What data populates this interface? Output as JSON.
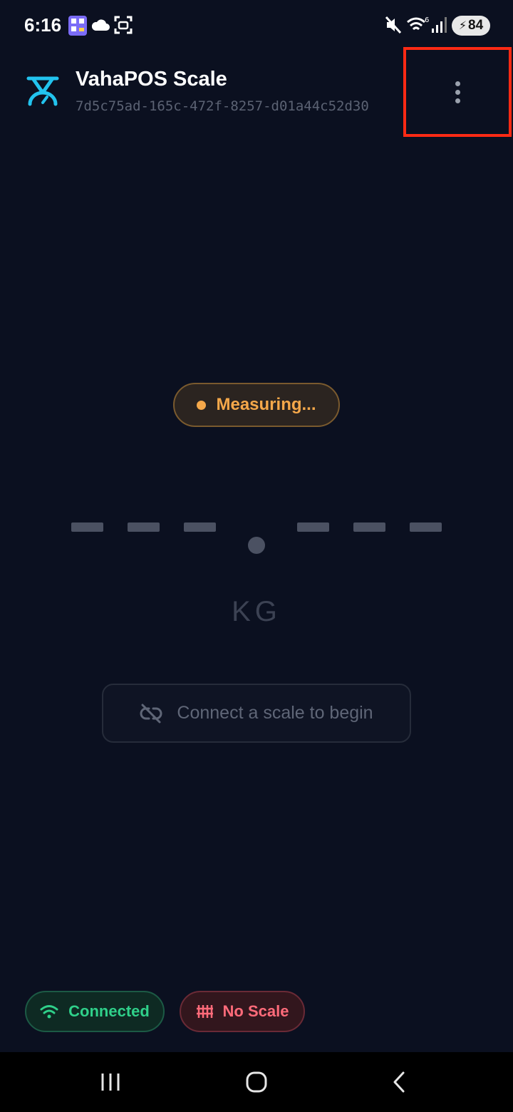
{
  "status_bar": {
    "time": "6:16",
    "battery": "84"
  },
  "app_bar": {
    "title": "VahaPOS Scale",
    "device_id": "7d5c75ad-165c-472f-8257-d01a44c52d30",
    "menu_icon": "more-vertical-icon",
    "accent_color": "#22c3ee"
  },
  "status_pill": {
    "text": "Measuring...",
    "color": "#f5a84a"
  },
  "readout": {
    "unit": "KG"
  },
  "connect_prompt": {
    "icon": "link-off-icon",
    "text": "Connect a scale to begin"
  },
  "chips": {
    "connected": {
      "label": "Connected",
      "icon": "wifi-icon",
      "color": "#2fd08a"
    },
    "no_scale": {
      "label": "No Scale",
      "icon": "scale-sliders-icon",
      "color": "#ff6b7a"
    }
  },
  "nav": {
    "recents_icon": "recents-icon",
    "home_icon": "home-icon",
    "back_icon": "back-icon"
  }
}
